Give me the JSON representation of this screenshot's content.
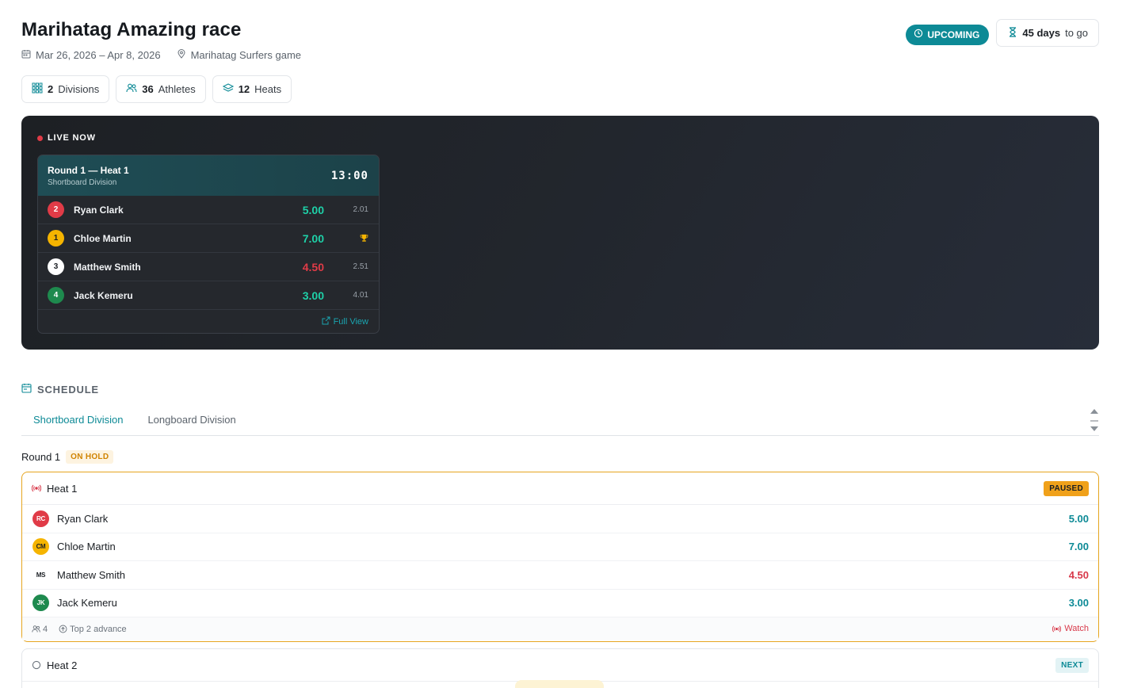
{
  "event": {
    "title": "Marihatag Amazing race",
    "dates": "Mar 26, 2026 – Apr 8, 2026",
    "location": "Marihatag Surfers game",
    "status": "UPCOMING",
    "countdown_value": "45 days",
    "countdown_suffix": "to go"
  },
  "stats": [
    {
      "value": "2",
      "label": "Divisions"
    },
    {
      "value": "36",
      "label": "Athletes"
    },
    {
      "value": "12",
      "label": "Heats"
    }
  ],
  "live": {
    "label": "LIVE NOW",
    "heat_title": "Round 1 — Heat 1",
    "division": "Shortboard Division",
    "timer": "13:00",
    "athletes": [
      {
        "position": "2",
        "name": "Ryan Clark",
        "score": "5.00",
        "extra": "2.01",
        "pos_color": "#e03b47",
        "score_color": "#1ed1a8"
      },
      {
        "position": "1",
        "name": "Chloe Martin",
        "score": "7.00",
        "extra": "",
        "pos_color": "#f5b400",
        "score_color": "#1ed1a8",
        "extra_icon": "trophy-icon"
      },
      {
        "position": "3",
        "name": "Matthew Smith",
        "score": "4.50",
        "extra": "2.51",
        "pos_color": "#ffffff",
        "score_color": "#e03b47"
      },
      {
        "position": "4",
        "name": "Jack Kemeru",
        "score": "3.00",
        "extra": "4.01",
        "pos_color": "#1e8a4e",
        "score_color": "#1ed1a8"
      }
    ],
    "full_view": "Full View"
  },
  "schedule": {
    "label": "SCHEDULE",
    "tabs": [
      "Shortboard Division",
      "Longboard Division"
    ],
    "active_tab": 0,
    "round": {
      "name": "Round 1",
      "status": "ON HOLD"
    },
    "heats": [
      {
        "name": "Heat 1",
        "status": "PAUSED",
        "athletes": [
          {
            "initials": "RC",
            "name": "Ryan Clark",
            "score": "5.00",
            "avatar_color": "#e03b47",
            "score_color": "#0d8a96"
          },
          {
            "initials": "CM",
            "name": "Chloe Martin",
            "score": "7.00",
            "avatar_color": "#f5b400",
            "score_color": "#0d8a96"
          },
          {
            "initials": "MS",
            "name": "Matthew Smith",
            "score": "4.50",
            "avatar_color": "#ffffff",
            "score_color": "#d8394a"
          },
          {
            "initials": "JK",
            "name": "Jack Kemeru",
            "score": "3.00",
            "avatar_color": "#1e8a4e",
            "score_color": "#0d8a96"
          }
        ],
        "athlete_count": "4",
        "advance": "Top 2 advance",
        "watch": "Watch"
      },
      {
        "name": "Heat 2",
        "status": "NEXT"
      }
    ]
  },
  "colors": {
    "accent": "#0d8a96",
    "live_red": "#e03b47",
    "paused": "#f0a11a"
  }
}
